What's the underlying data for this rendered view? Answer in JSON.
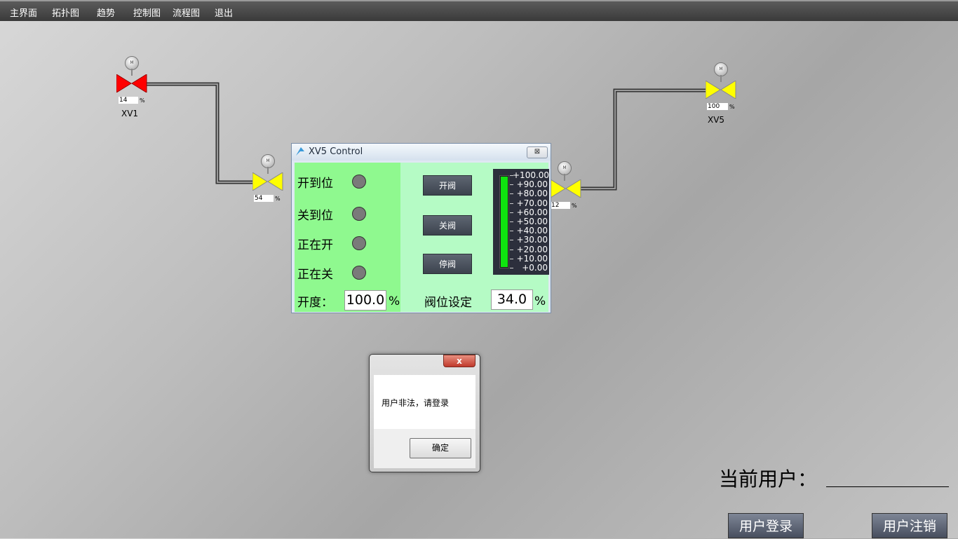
{
  "menu": [
    "主界面",
    "拓扑图",
    "趋势",
    "控制图",
    "流程图",
    "退出"
  ],
  "valves": {
    "xv1": {
      "name": "XV1",
      "percent": "14",
      "unit": "%",
      "color": "#ff0000"
    },
    "mid": {
      "percent": "54",
      "unit": "%",
      "color": "#ffff00"
    },
    "right": {
      "percent": "12",
      "unit": "%",
      "color": "#ffff00"
    },
    "xv5": {
      "name": "XV5",
      "percent": "100",
      "unit": "%",
      "color": "#ffff00"
    }
  },
  "actuator_label": "M",
  "control_window": {
    "title": "XV5 Control",
    "close": "⊠",
    "status_labels": [
      "开到位",
      "关到位",
      "正在开",
      "正在关"
    ],
    "buttons": {
      "open": "开阀",
      "close": "关阀",
      "stop": "停阀"
    },
    "gauge_ticks": [
      "+100.00",
      "+90.00",
      "+80.00",
      "+70.00",
      "+60.00",
      "+50.00",
      "+40.00",
      "+30.00",
      "+20.00",
      "+10.00",
      "+0.00"
    ],
    "gauge_level": 1.0,
    "opening_label": "开度：",
    "opening_value": "100.0",
    "opening_unit": "%",
    "setpoint_label": "阀位设定",
    "setpoint_value": "34.0",
    "setpoint_unit": "%"
  },
  "dialog": {
    "close": "x",
    "message": "用户非法，请登录",
    "ok": "确定"
  },
  "current_user_label": "当前用户：",
  "login_button": "用户登录",
  "logout_button": "用户注销",
  "colors": {
    "led_off": "#7a7a7a",
    "gauge_fill": "#0fe40f",
    "left_panel": "#8ff98f",
    "right_panel": "#b5fbc5"
  }
}
